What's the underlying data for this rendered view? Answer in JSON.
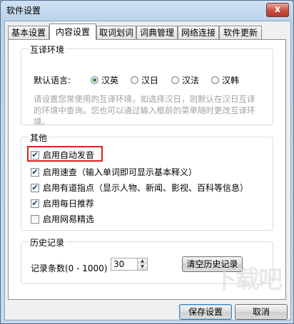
{
  "window": {
    "title": "软件设置",
    "close_glyph": "x"
  },
  "tabs": [
    {
      "label": "基本设置",
      "active": false
    },
    {
      "label": "内容设置",
      "active": true
    },
    {
      "label": "取词划词",
      "active": false
    },
    {
      "label": "词典管理",
      "active": false
    },
    {
      "label": "网络连接",
      "active": false
    },
    {
      "label": "软件更新",
      "active": false
    }
  ],
  "mutual": {
    "title": "互译环境",
    "default_lang_label": "默认语言:",
    "options": [
      {
        "label": "汉英",
        "selected": true
      },
      {
        "label": "汉日",
        "selected": false
      },
      {
        "label": "汉法",
        "selected": false
      },
      {
        "label": "汉韩",
        "selected": false
      }
    ],
    "hint": "请设置您常使用的互译环境，如选择汉日，则默认在汉日互译的环境中查询。您也可以通过输入框前的菜单随时更改互译环境。"
  },
  "other": {
    "title": "其他",
    "items": [
      {
        "label": "启用自动发音",
        "checked": true
      },
      {
        "label": "启用速查（输入单词即可显示基本释义）",
        "checked": true
      },
      {
        "label": "启用有道指点（显示人物、新闻、影视、百科等信息）",
        "checked": true
      },
      {
        "label": "启用每日推荐",
        "checked": true
      },
      {
        "label": "启用网易精选",
        "checked": false
      }
    ],
    "highlight_color": "#e0201a"
  },
  "history": {
    "title": "历史记录",
    "count_label": "记录条数(0 - 1000)",
    "count_value": "30",
    "clear_button": "清空历史记录"
  },
  "footer": {
    "save_button": "保存设置",
    "cancel_button": "取消"
  },
  "watermark": "下载吧"
}
